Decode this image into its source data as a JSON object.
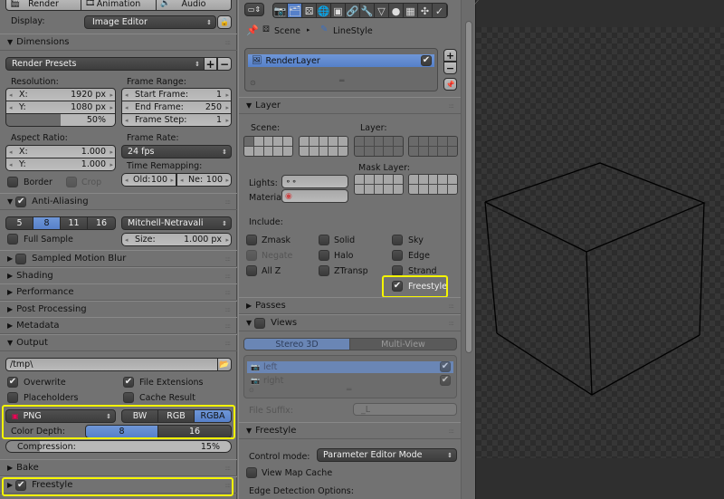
{
  "left_panel": {
    "tabs": [
      {
        "label": "Render",
        "icon": "render-icon"
      },
      {
        "label": "Animation",
        "icon": "animation-icon"
      },
      {
        "label": "Audio",
        "icon": "audio-icon"
      }
    ],
    "display_label": "Display:",
    "display_value": "Image Editor",
    "dimensions": {
      "title": "Dimensions",
      "presets": "Render Presets",
      "resolution_label": "Resolution:",
      "res_x_label": "X:",
      "res_x": "1920 px",
      "res_y_label": "Y:",
      "res_y": "1080 px",
      "res_pct": "50%",
      "res_pct_value": 0.5,
      "frame_range_label": "Frame Range:",
      "start_label": "Start Frame:",
      "start": "1",
      "end_label": "End Frame:",
      "end": "250",
      "step_label": "Frame Step:",
      "step": "1",
      "aspect_label": "Aspect Ratio:",
      "asp_x_label": "X:",
      "asp_x": "1.000",
      "asp_y_label": "Y:",
      "asp_y": "1.000",
      "frame_rate_label": "Frame Rate:",
      "frame_rate": "24 fps",
      "time_remap_label": "Time Remapping:",
      "old_label": "Old:",
      "old": "100",
      "new_label": "Ne:",
      "new": "100",
      "border_label": "Border",
      "crop_label": "Crop"
    },
    "anti_aliasing": {
      "title": "Anti-Aliasing",
      "checked": true,
      "samples": [
        "5",
        "8",
        "11",
        "16"
      ],
      "selected_sample": "8",
      "filter": "Mitchell-Netravali",
      "full_sample_label": "Full Sample",
      "size_label": "Size:",
      "size": "1.000 px"
    },
    "collapsed_panels": [
      {
        "label": "Sampled Motion Blur",
        "has_checkbox": true
      },
      {
        "label": "Shading"
      },
      {
        "label": "Performance"
      },
      {
        "label": "Post Processing"
      },
      {
        "label": "Metadata"
      }
    ],
    "output": {
      "title": "Output",
      "path": "/tmp\\",
      "overwrite_label": "Overwrite",
      "file_ext_label": "File Extensions",
      "placeholders_label": "Placeholders",
      "cache_result_label": "Cache Result",
      "format": "PNG",
      "color_modes": [
        "BW",
        "RGB",
        "RGBA"
      ],
      "selected_color_mode": "RGBA",
      "color_depth_label": "Color Depth:",
      "color_depths": [
        "8",
        "16"
      ],
      "selected_depth": "8",
      "compression_label": "Compression:",
      "compression": "15%",
      "compression_value": 0.15
    },
    "bake_label": "Bake",
    "freestyle_label": "Freestyle"
  },
  "mid_panel": {
    "tab_icons": [
      "render-icon",
      "render-layers-icon",
      "scene-icon",
      "world-icon",
      "object-icon",
      "constraints-icon",
      "modifiers-icon",
      "data-icon",
      "material-icon",
      "texture-icon",
      "particles-icon",
      "physics-icon"
    ],
    "breadcrumb": [
      "Scene",
      "LineStyle"
    ],
    "layer_list": [
      {
        "name": "RenderLayer",
        "checked": true
      }
    ],
    "layer_panel": {
      "title": "Layer",
      "scene_label": "Scene:",
      "layer_label": "Layer:",
      "mask_layer_label": "Mask Layer:",
      "lights_label": "Lights:",
      "material_label": "Materia"
    },
    "include": {
      "label": "Include:",
      "items": [
        {
          "label": "Zmask",
          "checked": false,
          "disabled": false
        },
        {
          "label": "Solid",
          "checked": false,
          "disabled": false
        },
        {
          "label": "Sky",
          "checked": false,
          "disabled": false
        },
        {
          "label": "Negate",
          "checked": false,
          "disabled": true
        },
        {
          "label": "Halo",
          "checked": false,
          "disabled": false
        },
        {
          "label": "Edge",
          "checked": false,
          "disabled": false
        },
        {
          "label": "All Z",
          "checked": false,
          "disabled": false
        },
        {
          "label": "ZTransp",
          "checked": false,
          "disabled": false
        },
        {
          "label": "Strand",
          "checked": false,
          "disabled": false
        },
        {
          "label": "Freestyle",
          "checked": true,
          "disabled": false
        }
      ]
    },
    "passes_label": "Passes",
    "views": {
      "title": "Views",
      "modes": [
        "Stereo 3D",
        "Multi-View"
      ],
      "selected_mode": "Stereo 3D",
      "list": [
        {
          "name": "left",
          "checked": true
        },
        {
          "name": "right",
          "checked": true
        }
      ],
      "file_suffix_label": "File Suffix:",
      "file_suffix": "_L"
    },
    "freestyle": {
      "title": "Freestyle",
      "control_mode_label": "Control mode:",
      "control_mode": "Parameter Editor Mode",
      "view_map_cache_label": "View Map Cache",
      "edge_detection_label": "Edge Detection Options:"
    }
  },
  "colors": {
    "panel": "#727272",
    "selection": "#5680c9",
    "highlight": "#f5f500",
    "viewport": "#2f2f2f"
  }
}
